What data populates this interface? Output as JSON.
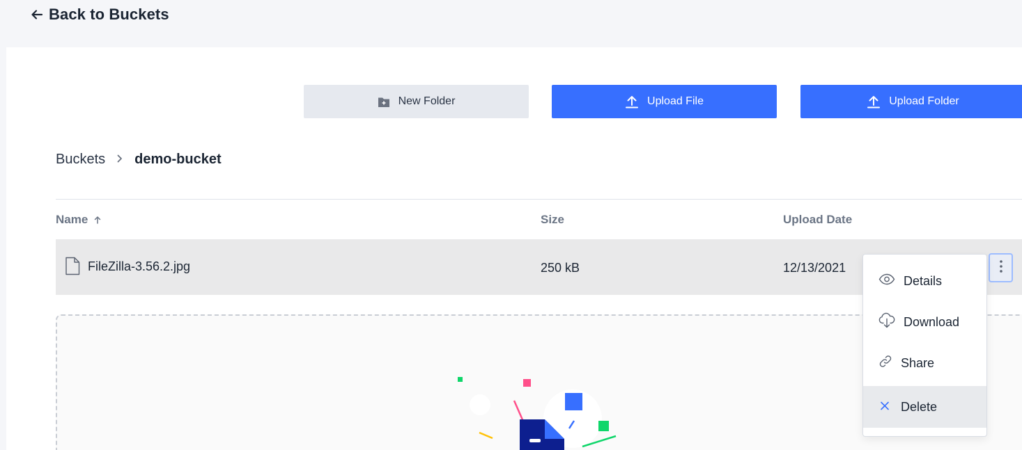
{
  "header": {
    "back_label": "Back to Buckets"
  },
  "toolbar": {
    "new_folder_label": "New Folder",
    "upload_file_label": "Upload File",
    "upload_folder_label": "Upload Folder"
  },
  "breadcrumb": {
    "root": "Buckets",
    "current": "demo-bucket"
  },
  "table": {
    "columns": {
      "name": "Name",
      "size": "Size",
      "upload_date": "Upload Date"
    },
    "rows": [
      {
        "name": "FileZilla-3.56.2.jpg",
        "size": "250 kB",
        "upload_date": "12/13/2021"
      }
    ]
  },
  "context_menu": {
    "items": [
      {
        "label": "Details",
        "icon": "eye-icon"
      },
      {
        "label": "Download",
        "icon": "cloud-download-icon"
      },
      {
        "label": "Share",
        "icon": "link-icon"
      },
      {
        "label": "Delete",
        "icon": "close-icon"
      }
    ]
  },
  "colors": {
    "primary": "#376fff",
    "secondary_button": "#e6e9ef",
    "row_selected": "#e9e9ea"
  }
}
